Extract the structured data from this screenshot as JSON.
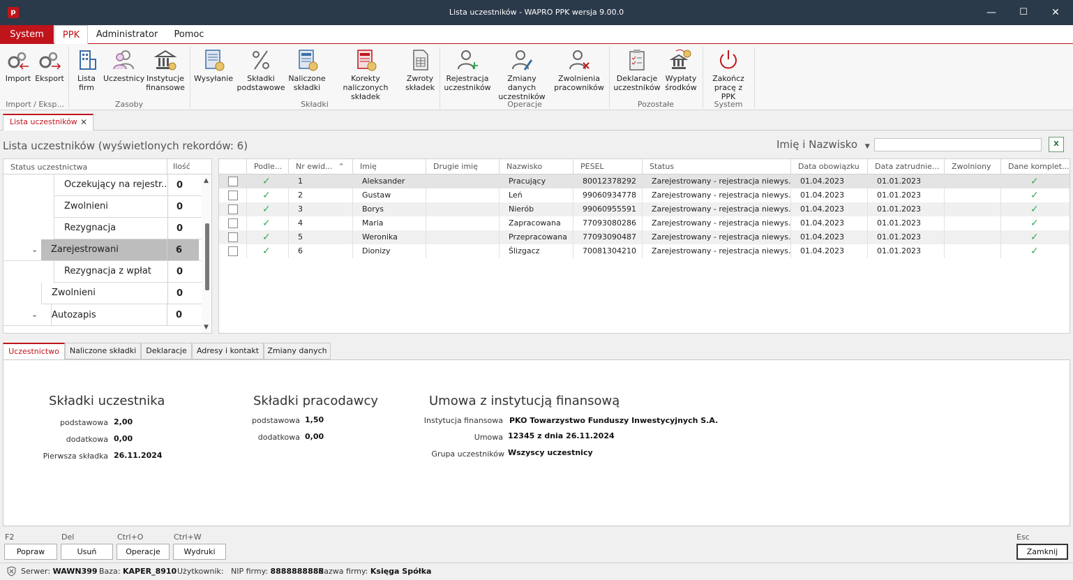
{
  "window": {
    "title": "Lista uczestników - WAPRO PPK wersja 9.00.0",
    "app_icon_letter": "p",
    "minimize": "—",
    "maximize": "☐",
    "close": "✕"
  },
  "menu": [
    "System",
    "PPK",
    "Administrator",
    "Pomoc"
  ],
  "ribbon": {
    "buttons": [
      {
        "label1": "Import",
        "label2": ""
      },
      {
        "label1": "Eksport",
        "label2": ""
      },
      {
        "label1": "Lista",
        "label2": "firm"
      },
      {
        "label1": "Uczestnicy",
        "label2": ""
      },
      {
        "label1": "Instytucje",
        "label2": "finansowe"
      },
      {
        "label1": "Wysyłanie",
        "label2": ""
      },
      {
        "label1": "Składki",
        "label2": "podstawowe"
      },
      {
        "label1": "Naliczone",
        "label2": "składki"
      },
      {
        "label1": "Korekty naliczonych",
        "label2": "składek"
      },
      {
        "label1": "Zwroty",
        "label2": "składek"
      },
      {
        "label1": "Rejestracja",
        "label2": "uczestników"
      },
      {
        "label1": "Zmiany danych",
        "label2": "uczestników"
      },
      {
        "label1": "Zwolnienia",
        "label2": "pracowników"
      },
      {
        "label1": "Deklaracje",
        "label2": "uczestników"
      },
      {
        "label1": "Wypłaty",
        "label2": "środków"
      },
      {
        "label1": "Zakończ",
        "label2": "pracę z PPK"
      }
    ],
    "groups": [
      "Import / Eksp...",
      "Zasoby",
      "Składki",
      "Operacje",
      "Pozostałe",
      "System"
    ]
  },
  "doc_tab": {
    "label": "Lista uczestników",
    "close": "✕"
  },
  "list_title": "Lista uczestników (wyświetlonych rekordów: 6)",
  "search": {
    "by": "Imię i Nazwisko",
    "placeholder": ""
  },
  "status_panel": {
    "headers": [
      "Status uczestnictwa",
      "Ilość"
    ],
    "rows": [
      {
        "label": "Oczekujący na rejestr...",
        "count": "0"
      },
      {
        "label": "Zwolnieni",
        "count": "0"
      },
      {
        "label": "Rezygnacja",
        "count": "0"
      },
      {
        "label": "Zarejestrowani",
        "count": "6"
      },
      {
        "label": "Rezygnacja z wpłat",
        "count": "0"
      },
      {
        "label": "Zwolnieni",
        "count": "0"
      },
      {
        "label": "Autozapis",
        "count": "0"
      }
    ]
  },
  "grid": {
    "headers": [
      "Podle...",
      "Nr ewid...",
      "Imię",
      "Drugie imię",
      "Nazwisko",
      "PESEL",
      "Status",
      "Data obowiązku",
      "Data zatrudnie...",
      "Zwolniony",
      "Dane komplet..."
    ],
    "rows": [
      {
        "nr": "1",
        "imie": "Aleksander",
        "drugie": "",
        "nazwisko": "Pracujący",
        "pesel": "80012378292",
        "status": "Zarejestrowany - rejestracja niewys...",
        "obow": "01.04.2023",
        "zatr": "01.01.2023",
        "zwol": ""
      },
      {
        "nr": "2",
        "imie": "Gustaw",
        "drugie": "",
        "nazwisko": "Leń",
        "pesel": "99060934778",
        "status": "Zarejestrowany - rejestracja niewys...",
        "obow": "01.04.2023",
        "zatr": "01.01.2023",
        "zwol": ""
      },
      {
        "nr": "3",
        "imie": "Borys",
        "drugie": "",
        "nazwisko": "Nierób",
        "pesel": "99060955591",
        "status": "Zarejestrowany - rejestracja niewys...",
        "obow": "01.04.2023",
        "zatr": "01.01.2023",
        "zwol": ""
      },
      {
        "nr": "4",
        "imie": "Maria",
        "drugie": "",
        "nazwisko": "Zapracowana",
        "pesel": "77093080286",
        "status": "Zarejestrowany - rejestracja niewys...",
        "obow": "01.04.2023",
        "zatr": "01.01.2023",
        "zwol": ""
      },
      {
        "nr": "5",
        "imie": "Weronika",
        "drugie": "",
        "nazwisko": "Przepracowana",
        "pesel": "77093090487",
        "status": "Zarejestrowany - rejestracja niewys...",
        "obow": "01.04.2023",
        "zatr": "01.01.2023",
        "zwol": ""
      },
      {
        "nr": "6",
        "imie": "Dionizy",
        "drugie": "",
        "nazwisko": "Ślizgacz",
        "pesel": "70081304210",
        "status": "Zarejestrowany - rejestracja niewys...",
        "obow": "01.04.2023",
        "zatr": "01.01.2023",
        "zwol": ""
      }
    ],
    "check_glyph": "✓",
    "sort_glyph": "⌃"
  },
  "detail_tabs": [
    "Uczestnictwo",
    "Naliczone składki",
    "Deklaracje",
    "Adresy i kontakt",
    "Zmiany danych"
  ],
  "detail": {
    "uczestnik": {
      "title": "Składki uczestnika",
      "podstawowa_label": "podstawowa",
      "podstawowa": "2,00",
      "dodatkowa_label": "dodatkowa",
      "dodatkowa": "0,00",
      "pierwsza_label": "Pierwsza składka",
      "pierwsza": "26.11.2024"
    },
    "pracodawca": {
      "title": "Składki pracodawcy",
      "podstawowa_label": "podstawowa",
      "podstawowa": "1,50",
      "dodatkowa_label": "dodatkowa",
      "dodatkowa": "0,00"
    },
    "umowa": {
      "title": "Umowa z instytucją finansową",
      "instytucja_label": "Instytucja finansowa",
      "instytucja": "PKO Towarzystwo Funduszy Inwestycyjnych S.A.",
      "umowa_label": "Umowa",
      "umowa": "12345 z dnia 26.11.2024",
      "grupa_label": "Grupa uczestników",
      "grupa": "Wszyscy uczestnicy"
    }
  },
  "buttons": {
    "popraw": {
      "key": "F2",
      "label": "Popraw"
    },
    "usun": {
      "key": "Del",
      "label": "Usuń"
    },
    "operacje": {
      "key": "Ctrl+O",
      "label": "Operacje"
    },
    "wydruki": {
      "key": "Ctrl+W",
      "label": "Wydruki"
    },
    "zamknij": {
      "key": "Esc",
      "label": "Zamknij"
    }
  },
  "statusbar": {
    "serwer_label": "Serwer:",
    "serwer": "WAWN399",
    "baza_label": "Baza:",
    "baza": "KAPER_8910",
    "uzytkownik_label": "Użytkownik:",
    "nip_label": "NIP firmy:",
    "nip": "8888888888",
    "nazwa_label": "Nazwa firmy:",
    "nazwa": "Księga Spółka"
  },
  "colors": {
    "accent": "#c0141b",
    "titlebar": "#2b3a4a",
    "check": "#3aa757"
  }
}
